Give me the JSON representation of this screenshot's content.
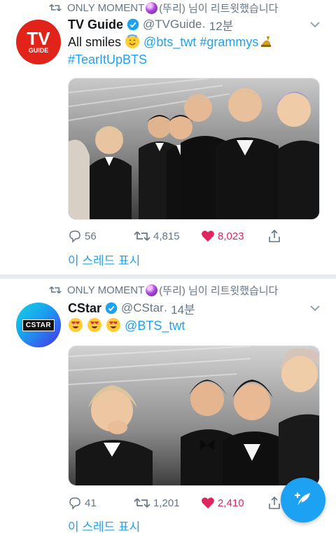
{
  "tweets": [
    {
      "retweeted_by": "ONLY MOMENT",
      "retweeted_suffix": "(뚜리) 님이 리트윗했습니다",
      "avatar": {
        "main": "TV",
        "sub": "GUIDE",
        "color": "#e2231a"
      },
      "name": "TV Guide",
      "handle": "@TVGuide",
      "time": "· 12분",
      "text_plain": "All smiles",
      "mention": "@bts_twt",
      "hashtag1": "#grammys",
      "hashtag2": "#TearItUpBTS",
      "replies": "56",
      "retweets": "4,815",
      "likes": "8,023",
      "thread_label": "이 스레드 표시"
    },
    {
      "retweeted_by": "ONLY MOMENT",
      "retweeted_suffix": "(뚜리) 님이 리트윗했습니다",
      "avatar": {
        "main": "CSTAR"
      },
      "name": "CStar",
      "handle": "@CStar",
      "time": "· 14분",
      "mention": "@BTS_twt",
      "replies": "41",
      "retweets": "1,201",
      "likes": "2,410",
      "thread_label": "이 스레드 표시"
    }
  ],
  "colors": {
    "link": "#1da1f2",
    "like": "#e0245e",
    "muted": "#657786"
  },
  "icons": [
    "retweet-icon",
    "verified-icon",
    "chevron-down-icon",
    "reply-icon",
    "heart-icon",
    "share-icon",
    "compose-icon"
  ]
}
